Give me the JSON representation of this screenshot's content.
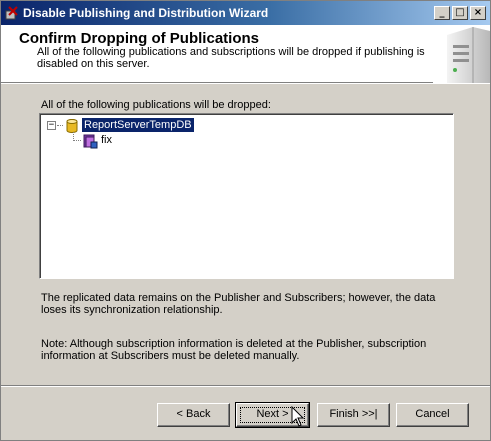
{
  "window": {
    "title": "Disable Publishing and Distribution Wizard",
    "controls": {
      "minimize": "_",
      "maximize": "□",
      "close": "×"
    }
  },
  "header": {
    "title": "Confirm Dropping of Publications",
    "description": "All of the following publications and subscriptions will be dropped if publishing is disabled on this server."
  },
  "main": {
    "list_label": "All of the following publications will be dropped:",
    "tree": {
      "expander": "−",
      "root": {
        "label": "ReportServerTempDB",
        "icon": "database-icon"
      },
      "children": [
        {
          "label": "fix",
          "icon": "publication-icon"
        }
      ]
    },
    "info_text": "The replicated data remains on the Publisher and Subscribers; however, the data loses its synchronization relationship.",
    "note_text": "Note: Although subscription information is deleted at the Publisher, subscription information at Subscribers must be deleted manually."
  },
  "footer": {
    "back_label": "< Back",
    "next_label": "Next >",
    "finish_label": "Finish >>|",
    "cancel_label": "Cancel"
  },
  "colors": {
    "title_bar": "#0a246a",
    "selection": "#0a246a",
    "face": "#d4d0c8"
  }
}
